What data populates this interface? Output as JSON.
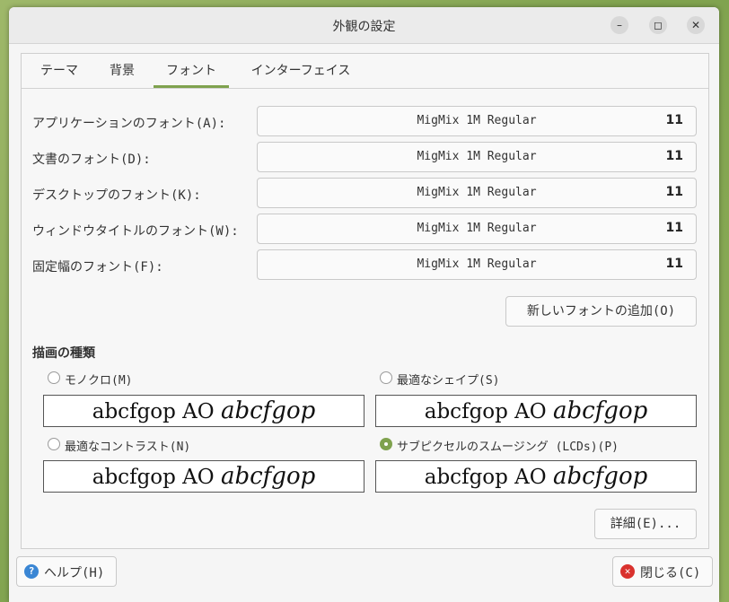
{
  "window": {
    "title": "外観の設定"
  },
  "titlebar_buttons": {
    "minimize": "–",
    "maximize": "◻",
    "close": "✕"
  },
  "tabs": [
    {
      "label": "テーマ"
    },
    {
      "label": "背景"
    },
    {
      "label": "フォント",
      "active": true
    },
    {
      "label": "インターフェイス"
    }
  ],
  "fonts": [
    {
      "label": "アプリケーションのフォント(A):",
      "font": "MigMix 1M Regular",
      "size": "11"
    },
    {
      "label": "文書のフォント(D):",
      "font": "MigMix 1M Regular",
      "size": "11"
    },
    {
      "label": "デスクトップのフォント(K):",
      "font": "MigMix 1M Regular",
      "size": "11"
    },
    {
      "label": "ウィンドウタイトルのフォント(W):",
      "font": "MigMix 1M Regular",
      "size": "11"
    },
    {
      "label": "固定幅のフォント(F):",
      "font": "MigMix 1M Regular",
      "size": "11"
    }
  ],
  "add_font_button": "新しいフォントの追加(O)",
  "rendering": {
    "title": "描画の種類",
    "options": [
      {
        "label": "モノクロ(M)",
        "selected": false,
        "preview_plain": "abcfgop AO ",
        "preview_italic": "abcfgop"
      },
      {
        "label": "最適なシェイプ(S)",
        "selected": false,
        "preview_plain": "abcfgop AO ",
        "preview_italic": "abcfgop"
      },
      {
        "label": "最適なコントラスト(N)",
        "selected": false,
        "preview_plain": "abcfgop AO ",
        "preview_italic": "abcfgop"
      },
      {
        "label": "サブピクセルのスムージング (LCDs)(P)",
        "selected": true,
        "preview_plain": "abcfgop AO ",
        "preview_italic": "abcfgop"
      }
    ]
  },
  "details_button": "詳細(E)...",
  "help_button": {
    "label": "ヘルプ(H)",
    "icon": "help-icon",
    "icon_glyph": "?"
  },
  "close_button": {
    "label": "閉じる(C)",
    "icon": "close-circle-icon",
    "icon_glyph": "✕"
  },
  "colors": {
    "accent": "#7fa24e",
    "help_icon": "#3a86d4",
    "close_icon": "#d9322e"
  }
}
